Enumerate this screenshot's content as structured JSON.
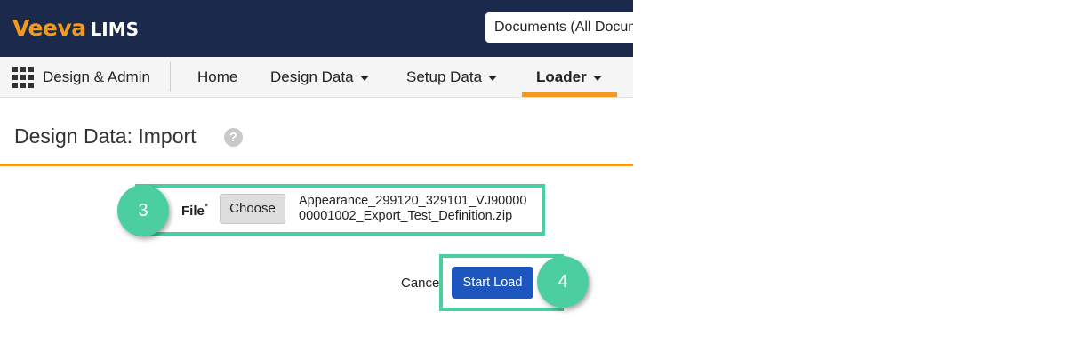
{
  "header": {
    "logo_brand": "Veeva",
    "logo_product": "LIMS",
    "object_selector": "Documents (All Documents)"
  },
  "nav": {
    "apps_label": "Design & Admin",
    "items": [
      {
        "label": "Home",
        "has_menu": false
      },
      {
        "label": "Design Data",
        "has_menu": true
      },
      {
        "label": "Setup Data",
        "has_menu": true
      },
      {
        "label": "Loader",
        "has_menu": true,
        "active": true
      }
    ]
  },
  "page": {
    "title": "Design Data: Import",
    "help_icon": "?"
  },
  "form": {
    "file_label": "File",
    "required_marker": "*",
    "choose_button": "Choose",
    "file_name": "Appearance_299120_329101_VJ9000000001002_Export_Test_Definition.zip"
  },
  "actions": {
    "cancel": "Cancel",
    "start_load": "Start Load"
  },
  "steps": {
    "file_step": "3",
    "load_step": "4"
  },
  "colors": {
    "header_bg": "#1b2a4a",
    "accent_orange": "#f39a1e",
    "highlight_green": "#4ccfa0",
    "primary_button": "#1e56c0"
  }
}
